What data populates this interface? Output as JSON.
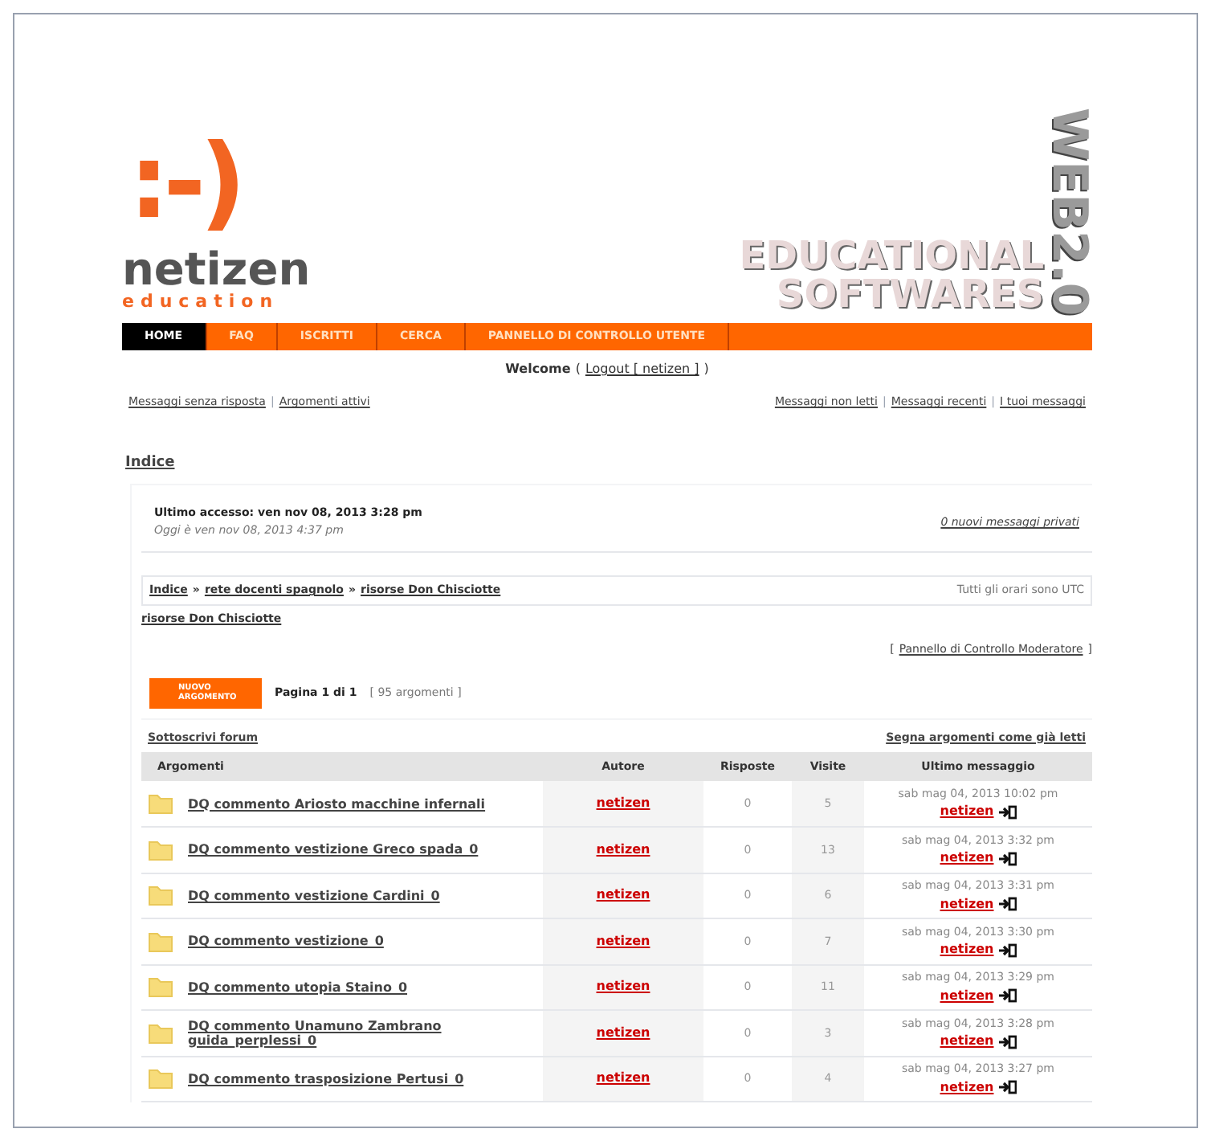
{
  "logo": {
    "smiley": ":-)",
    "name": "netizen",
    "tagline": "education"
  },
  "banner": {
    "line_1": "EDUCATIONAL",
    "line_2": "SOFTWARES",
    "vertical": "WEB2.0"
  },
  "nav": [
    {
      "label": "HOME",
      "selected": true
    },
    {
      "label": "FAQ",
      "selected": false
    },
    {
      "label": "ISCRITTI",
      "selected": false
    },
    {
      "label": "CERCA",
      "selected": false
    },
    {
      "label": "PANNELLO DI CONTROLLO UTENTE",
      "selected": false
    }
  ],
  "welcome": {
    "label": "Welcome",
    "open": "(",
    "link": "Logout [ netizen ]",
    "close": ")"
  },
  "link_sep": "|",
  "moderator_brackets": [
    "[",
    "]"
  ],
  "links_left": [
    "Messaggi senza risposta",
    "Argomenti attivi"
  ],
  "links_right": [
    "Messaggi non letti",
    "Messaggi recenti",
    "I tuoi messaggi"
  ],
  "index_link": "Indice",
  "last_access": "Ultimo accesso: ven nov 08, 2013 3:28 pm",
  "today": "Oggi è ven nov 08, 2013 4:37 pm",
  "private_messages": "0 nuovi messaggi privati",
  "breadcrumb": [
    "Indice",
    "rete docenti spagnolo",
    "risorse Don Chisciotte"
  ],
  "breadcrumb_sep": "»",
  "timezone": "Tutti gli orari sono UTC",
  "forum_title": "risorse Don Chisciotte",
  "moderator_link": "Pannello di Controllo Moderatore",
  "new_topic": {
    "line_1": "NUOVO",
    "line_2": "ARGOMENTO"
  },
  "pagination": {
    "page": "Pagina 1 di 1",
    "count": "[ 95 argomenti ]"
  },
  "subscribe": "Sottoscrivi forum",
  "mark_read": "Segna argomenti come già letti",
  "table": {
    "columns": [
      "Argomenti",
      "Autore",
      "Risposte",
      "Visite",
      "Ultimo messaggio"
    ],
    "rows": [
      {
        "title": "DQ commento Ariosto macchine infernali",
        "author": "netizen",
        "replies": "0",
        "views": "5",
        "last_date": "sab mag 04, 2013 10:02 pm",
        "last_author": "netizen"
      },
      {
        "title": "DQ commento vestizione Greco spada_0",
        "author": "netizen",
        "replies": "0",
        "views": "13",
        "last_date": "sab mag 04, 2013 3:32 pm",
        "last_author": "netizen"
      },
      {
        "title": "DQ commento vestizione Cardini_0",
        "author": "netizen",
        "replies": "0",
        "views": "6",
        "last_date": "sab mag 04, 2013 3:31 pm",
        "last_author": "netizen"
      },
      {
        "title": "DQ commento vestizione_0",
        "author": "netizen",
        "replies": "0",
        "views": "7",
        "last_date": "sab mag 04, 2013 3:30 pm",
        "last_author": "netizen"
      },
      {
        "title": "DQ commento utopia Staino_0",
        "author": "netizen",
        "replies": "0",
        "views": "11",
        "last_date": "sab mag 04, 2013 3:29 pm",
        "last_author": "netizen"
      },
      {
        "title": "DQ commento Unamuno Zambrano guida_perplessi_0",
        "author": "netizen",
        "replies": "0",
        "views": "3",
        "last_date": "sab mag 04, 2013 3:28 pm",
        "last_author": "netizen"
      },
      {
        "title": "DQ commento trasposizione Pertusi_0",
        "author": "netizen",
        "replies": "0",
        "views": "4",
        "last_date": "sab mag 04, 2013 3:27 pm",
        "last_author": "netizen"
      }
    ]
  }
}
